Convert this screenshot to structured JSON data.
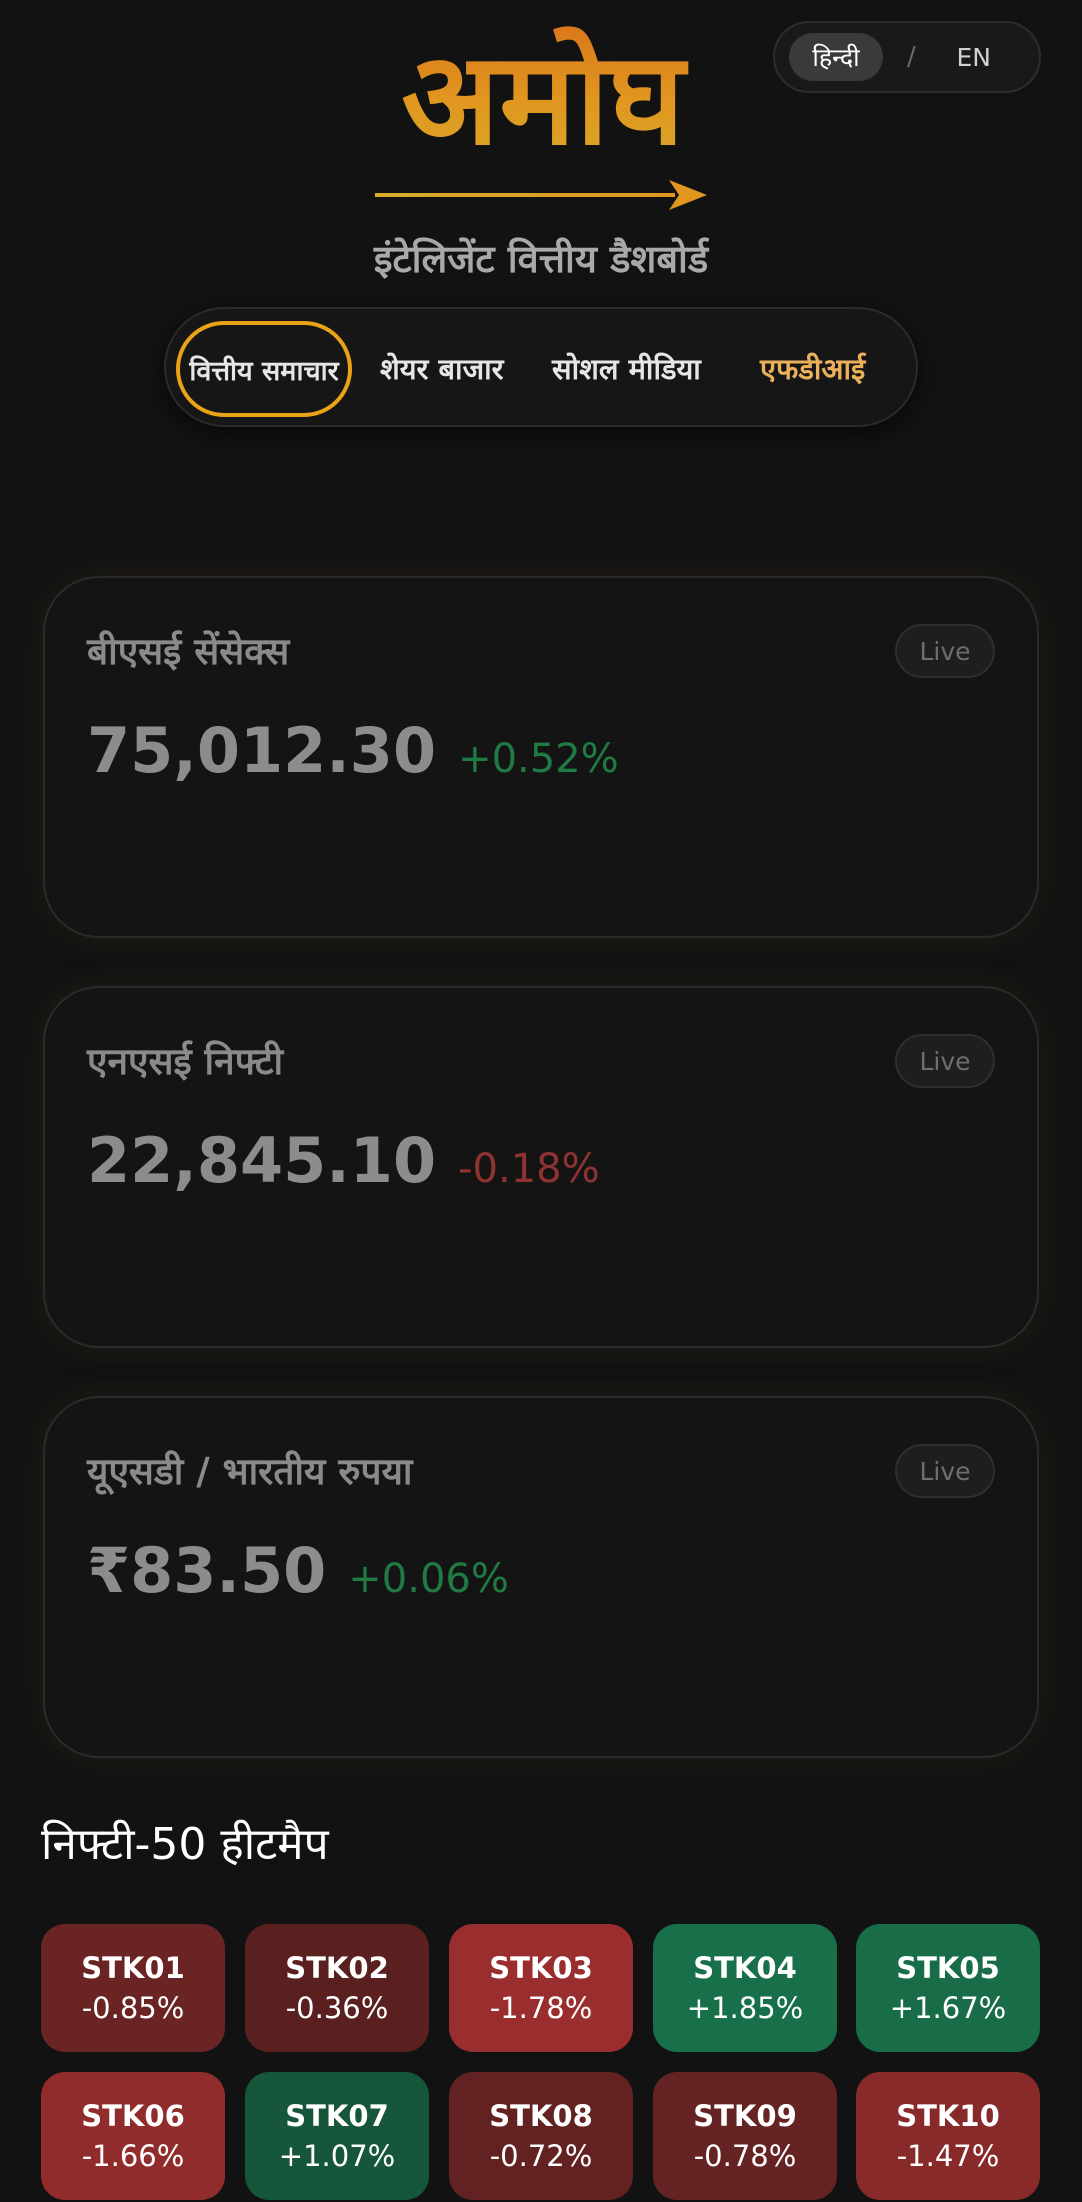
{
  "language_toggle": {
    "hindi_label": "हिन्दी",
    "separator": "/",
    "english_label": "EN",
    "active": "hindi"
  },
  "brand": {
    "logo_text": "अमोघ",
    "subtitle": "इंटेलिजेंट वित्तीय डैशबोर्ड",
    "logo_gradient": [
      "#d9731c",
      "#d8ab2a"
    ]
  },
  "nav": {
    "items": [
      {
        "label": "वित्तीय समाचार",
        "active": true
      },
      {
        "label": "शेयर बाजार"
      },
      {
        "label": "सोशल मीडिया"
      },
      {
        "label": "एफडीआई",
        "accent": true
      }
    ],
    "active_ring_color": "#e8a317"
  },
  "cards": [
    {
      "title": "बीएसई सेंसेक्स",
      "badge": "Live",
      "value": "75,012.30",
      "change": "+0.52%",
      "direction": "up"
    },
    {
      "title": "एनएसई निफ्टी",
      "badge": "Live",
      "value": "22,845.10",
      "change": "-0.18%",
      "direction": "down"
    },
    {
      "title": "यूएसडी / भारतीय रुपया",
      "badge": "Live",
      "value": "₹83.50",
      "change": "+0.06%",
      "direction": "up"
    }
  ],
  "heatmap": {
    "title": "निफ्टी-50 हीटमैप",
    "tiles": [
      {
        "symbol": "STK01",
        "change": "-0.85%",
        "color": "#6b2424"
      },
      {
        "symbol": "STK02",
        "change": "-0.36%",
        "color": "#5a2020"
      },
      {
        "symbol": "STK03",
        "change": "-1.78%",
        "color": "#9a2e2e"
      },
      {
        "symbol": "STK04",
        "change": "+1.85%",
        "color": "#18704a"
      },
      {
        "symbol": "STK05",
        "change": "+1.67%",
        "color": "#186c47"
      },
      {
        "symbol": "STK06",
        "change": "-1.66%",
        "color": "#912c2c"
      },
      {
        "symbol": "STK07",
        "change": "+1.07%",
        "color": "#16563b"
      },
      {
        "symbol": "STK08",
        "change": "-0.72%",
        "color": "#632222"
      },
      {
        "symbol": "STK09",
        "change": "-0.78%",
        "color": "#652323"
      },
      {
        "symbol": "STK10",
        "change": "-1.47%",
        "color": "#882a2a"
      }
    ]
  }
}
